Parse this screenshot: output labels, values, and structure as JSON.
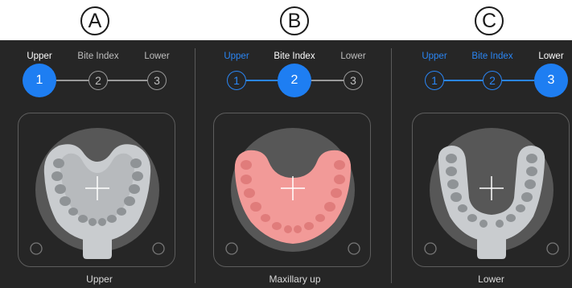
{
  "panels": [
    {
      "label": "A",
      "steps": [
        {
          "text": "Upper",
          "number": "1",
          "state": "active"
        },
        {
          "text": "Bite Index",
          "number": "2",
          "state": "todo"
        },
        {
          "text": "Lower",
          "number": "3",
          "state": "todo"
        }
      ],
      "caption": "Upper",
      "view": "upper-tray"
    },
    {
      "label": "B",
      "steps": [
        {
          "text": "Upper",
          "number": "1",
          "state": "done"
        },
        {
          "text": "Bite Index",
          "number": "2",
          "state": "active"
        },
        {
          "text": "Lower",
          "number": "3",
          "state": "todo"
        }
      ],
      "caption": "Maxillary up",
      "view": "maxillary-arch"
    },
    {
      "label": "C",
      "steps": [
        {
          "text": "Upper",
          "number": "1",
          "state": "done"
        },
        {
          "text": "Bite Index",
          "number": "2",
          "state": "done"
        },
        {
          "text": "Lower",
          "number": "3",
          "state": "active"
        }
      ],
      "caption": "Lower",
      "view": "lower-tray"
    }
  ],
  "colors": {
    "background": "#262626",
    "accent": "#1e7ef2",
    "inactive_text": "#bfbfbf",
    "gum_pink": "#f29a98",
    "tray_gray": "#c9cccf"
  },
  "icons": [
    "crosshair-icon",
    "tray-handle-icon",
    "tooth-icon"
  ]
}
